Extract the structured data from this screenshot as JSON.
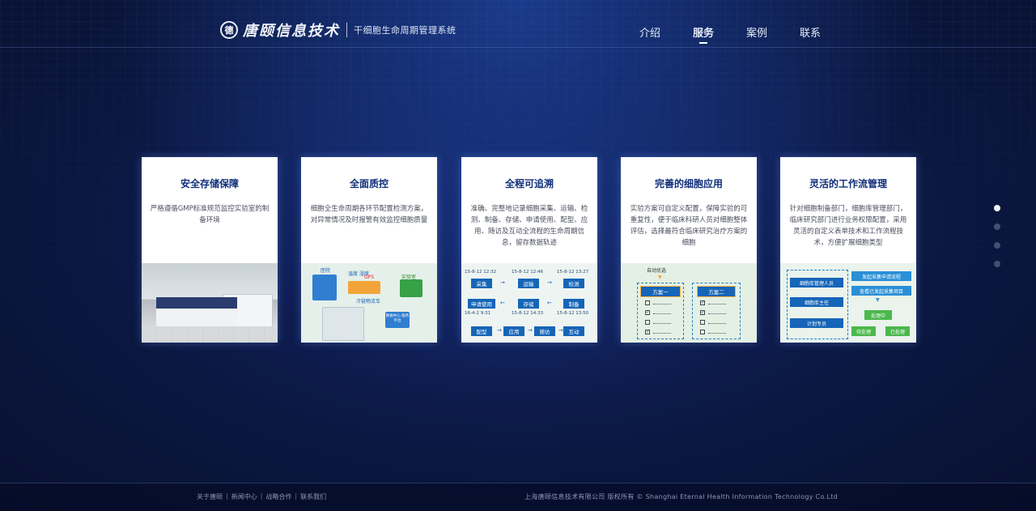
{
  "header": {
    "logo_seal": "德",
    "logo_name": "唐颐信息技术",
    "subtitle": "干细胞生命周期管理系统",
    "nav": [
      {
        "label": "介绍",
        "active": false
      },
      {
        "label": "服务",
        "active": true
      },
      {
        "label": "案例",
        "active": false
      },
      {
        "label": "联系",
        "active": false
      }
    ]
  },
  "cards": [
    {
      "title": "安全存储保障",
      "desc": "严格遵循GMP标准规范监控实验室的制备环境",
      "illustration": "laboratory-photo"
    },
    {
      "title": "全面质控",
      "desc": "细胞全生命周期各环节配置检测方案，对异常情况及时报警有效监控细胞质量",
      "illustration": "quality-control-map",
      "labels": {
        "hospital": "医院",
        "gps": "GPS",
        "temp": "温度 湿度",
        "lab": "实验室",
        "truck": "冷链物流车",
        "center": "数据中心 服务平台"
      }
    },
    {
      "title": "全程可追溯",
      "desc": "准确、完整地记录细胞采集、运输、检测、制备、存储、申请使用、配型、应用、随访及互动全流程的生命周期信息，留存数据轨迹",
      "illustration": "trace-flow",
      "flow": [
        {
          "date": "15-8-12 12:32",
          "step": "采集"
        },
        {
          "date": "15-8-12 12:46",
          "step": "运输"
        },
        {
          "date": "15-8-12 13:27",
          "step": "检测"
        },
        {
          "date": "",
          "step": "申请使用"
        },
        {
          "date": "",
          "step": "存储"
        },
        {
          "date": "",
          "step": "制备"
        },
        {
          "date": "16-4-2 9:31",
          "step": "配型"
        },
        {
          "date": "15-8-12 14:33",
          "step": "应用"
        },
        {
          "date": "15-8-12 13:50",
          "step": "随访"
        },
        {
          "date": "",
          "step": "互动"
        }
      ]
    },
    {
      "title": "完善的细胞应用",
      "desc": "实验方案可自定义配置，保障实验的可重复性，便于临床科研人员对细胞整体评估，选择最符合临床研究治疗方案的细胞",
      "illustration": "plan-compare",
      "labels": {
        "auto": "自动优选",
        "plan_a": "方案一",
        "plan_b": "方案二"
      }
    },
    {
      "title": "灵活的工作流管理",
      "desc": "针对细胞制备部门，细胞库管理部门，临床研究部门进行业务权限配置，采用灵活的自定义表单技术和工作流程技术，方便扩展细胞类型",
      "illustration": "workflow",
      "labels": {
        "r1": "细胞库管理人员",
        "r2": "细胞库主任",
        "r3": "计划专员",
        "a1": "发起采集申请流程",
        "a2": "查看已发起采集项目",
        "s1": "处理中",
        "s2": "待处理",
        "s3": "已处理"
      }
    }
  ],
  "pager": {
    "count": 4,
    "active_index": 0
  },
  "footer": {
    "links": [
      "关于唐颐",
      "新闻中心",
      "战略合作",
      "联系我们"
    ],
    "copyright": "上海唐颐信息技术有限公司 版权所有 © Shanghai Eternal Health Information Technology Co.Ltd"
  },
  "colors": {
    "accent": "#0f2f7a",
    "flow_blue": "#1565b8",
    "bg_dark": "#0b1740"
  }
}
